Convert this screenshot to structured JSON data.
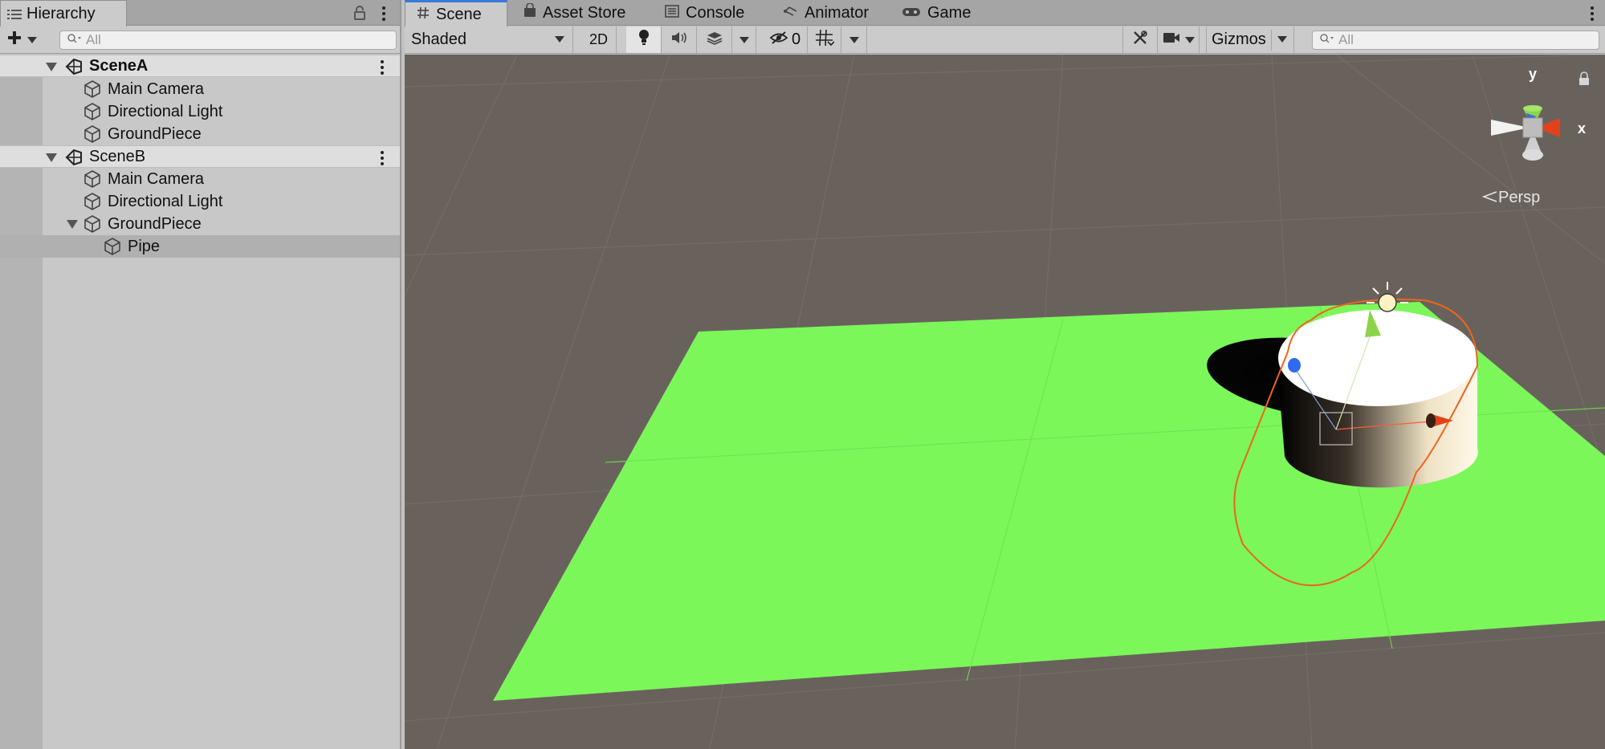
{
  "hierarchy": {
    "tab_label": "Hierarchy",
    "search_placeholder": "All",
    "scenes": [
      {
        "name": "SceneA",
        "children": [
          "Main Camera",
          "Directional Light",
          "GroundPiece"
        ]
      },
      {
        "name": "SceneB",
        "children": [
          "Main Camera",
          "Directional Light",
          "GroundPiece"
        ],
        "nested_child": "Pipe"
      }
    ],
    "selected_item": "Pipe"
  },
  "scene_view": {
    "tabs": [
      "Scene",
      "Asset Store",
      "Console",
      "Animator",
      "Game"
    ],
    "active_tab": "Scene",
    "shading_mode": "Shaded",
    "mode_2d_label": "2D",
    "hidden_count": "0",
    "gizmos_label": "Gizmos",
    "search_placeholder": "All",
    "axis_y": "y",
    "axis_x": "x",
    "projection_label": "Persp"
  },
  "colors": {
    "ground": "#7bf75a",
    "background": "#69625c",
    "selection_outline": "#f0641e",
    "active_tab_accent": "#3a79d6"
  },
  "icons": [
    "menu-list-icon",
    "lock-icon",
    "kebab-icon",
    "plus-icon",
    "search-icon",
    "unity-scene-icon",
    "cube-icon",
    "grid-icon",
    "bag-icon",
    "console-icon",
    "animator-icon",
    "gamepad-icon",
    "light-icon",
    "audio-icon",
    "effects-icon",
    "visibility-icon",
    "grid-snap-icon",
    "tools-icon",
    "camera-icon"
  ]
}
